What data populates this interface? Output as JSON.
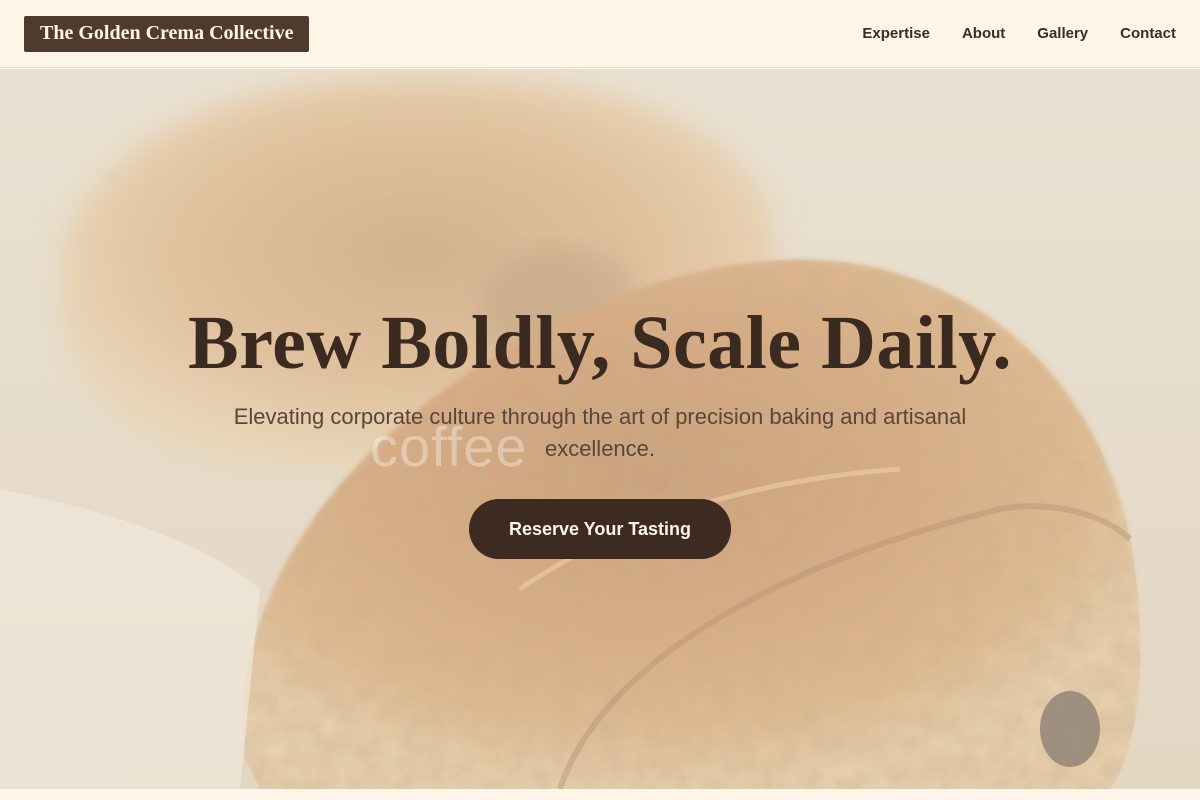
{
  "brand": {
    "name": "The Golden Crema Collective"
  },
  "nav": {
    "items": [
      {
        "label": "Expertise"
      },
      {
        "label": "About"
      },
      {
        "label": "Gallery"
      },
      {
        "label": "Contact"
      }
    ]
  },
  "hero": {
    "headline": "Brew Boldly, Scale Daily.",
    "subtitle": "Elevating corporate culture through the art of precision baking and artisanal excellence.",
    "background_watermark": "coffee"
  },
  "cta": {
    "label": "Reserve Your Tasting"
  },
  "colors": {
    "brand_bg": "#4e3b2e",
    "nav_bg": "#fdf6e6",
    "text_dark": "#3b2a20",
    "button_bg": "#3d2a20"
  }
}
